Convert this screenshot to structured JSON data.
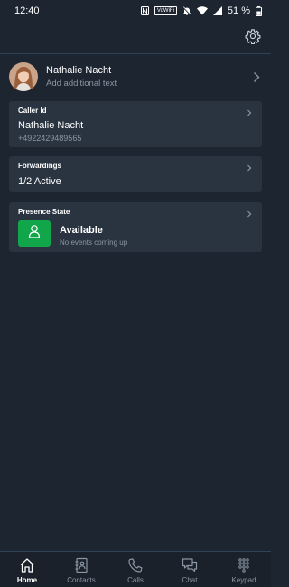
{
  "status_bar": {
    "time": "12:40",
    "vowifi": "VoWiFi",
    "battery": "51 %"
  },
  "app_bar": {
    "settings_icon": "gear-icon"
  },
  "profile": {
    "name": "Nathalie Nacht",
    "subtitle": "Add additional text",
    "avatar_icon": "avatar"
  },
  "caller_id": {
    "title": "Caller Id",
    "name": "Nathalie Nacht",
    "number": "+4922429489565"
  },
  "forwardings": {
    "title": "Forwardings",
    "status": "1/2 Active"
  },
  "presence": {
    "title": "Presence State",
    "status": "Available",
    "subtitle": "No events coming up",
    "color": "#12a64a"
  },
  "bottom_nav": {
    "items": [
      {
        "label": "Home",
        "icon": "home-icon",
        "active": true
      },
      {
        "label": "Contacts",
        "icon": "contacts-icon",
        "active": false
      },
      {
        "label": "Calls",
        "icon": "phone-icon",
        "active": false
      },
      {
        "label": "Chat",
        "icon": "chat-icon",
        "active": false
      },
      {
        "label": "Keypad",
        "icon": "keypad-icon",
        "active": false
      }
    ]
  },
  "colors": {
    "background": "#1d2530",
    "card": "#2a3441",
    "accent_green": "#12a64a",
    "muted_text": "#8a96a3"
  }
}
